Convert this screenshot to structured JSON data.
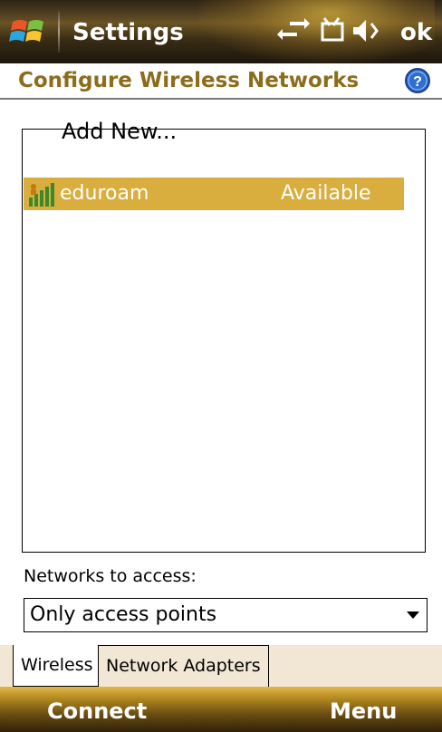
{
  "window": {
    "title": "Settings",
    "ok_label": "ok"
  },
  "header": {
    "title": "Configure Wireless Networks",
    "help_icon": "help-icon"
  },
  "networks": {
    "add_new_label": "Add New...",
    "items": [
      {
        "name": "eduroam",
        "status": "Available",
        "icon": "signal-strength-icon",
        "selected": true
      }
    ]
  },
  "access": {
    "label": "Networks to access:",
    "selected_value": "Only access points"
  },
  "tabs": [
    {
      "label": "Wireless",
      "active": true
    },
    {
      "label": "Network Adapters",
      "active": false
    }
  ],
  "softkeys": {
    "left": "Connect",
    "right": "Menu"
  },
  "colors": {
    "accent": "#d9ae3e",
    "title_text": "#8b6d1b",
    "tab_bg": "#f2e7d4"
  }
}
